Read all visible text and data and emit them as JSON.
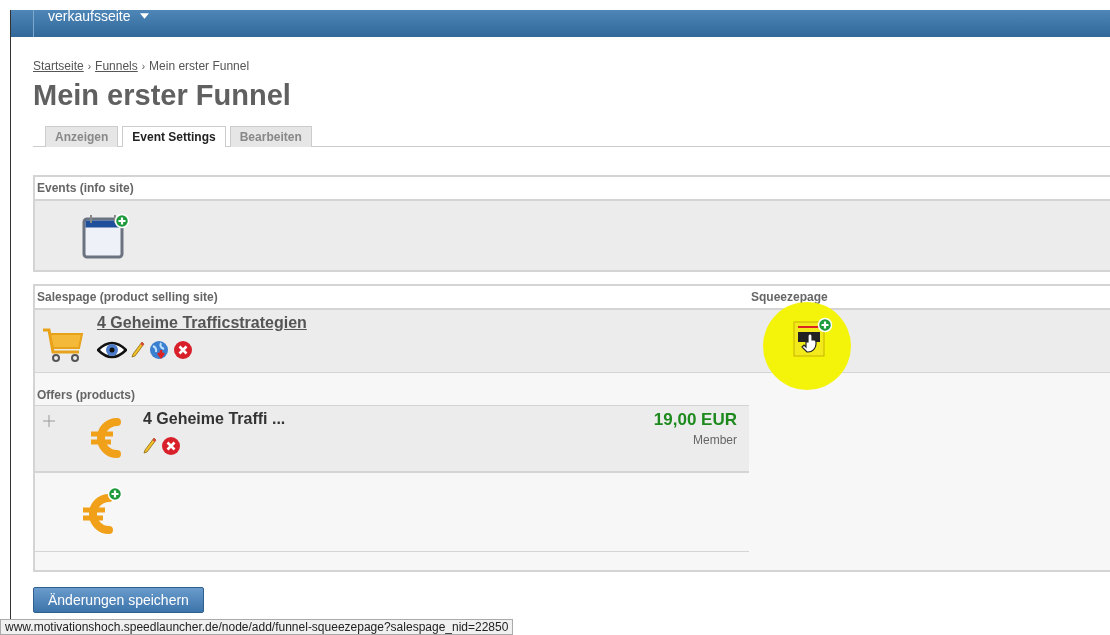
{
  "top_bar": {
    "menu_label": "verkaufsseite"
  },
  "breadcrumb": {
    "separator": "›",
    "items": [
      {
        "label": "Startseite",
        "kind": "link"
      },
      {
        "label": "Funnels",
        "kind": "link"
      },
      {
        "label": "Mein erster Funnel",
        "kind": "current"
      }
    ]
  },
  "title": "Mein erster Funnel",
  "tabs": [
    {
      "label": "Anzeigen",
      "selected": false
    },
    {
      "label": "Event Settings",
      "selected": true
    },
    {
      "label": "Bearbeiten",
      "selected": false
    }
  ],
  "events": {
    "heading": "Events (info site)"
  },
  "salespage": {
    "heading": "Salespage (product selling site)",
    "name": "4 Geheime Trafficstrategien"
  },
  "squeezepage": {
    "heading": "Squeezepage",
    "cursor_highlight": true
  },
  "offers": {
    "heading": "Offers (products)",
    "items": [
      {
        "name": "4 Geheime Traffi ...",
        "price": "19,00 EUR",
        "group": "Member"
      }
    ]
  },
  "save_button": "Änderungen speichern",
  "status_bar": "www.motivationshoch.speedlauncher.de/node/add/funnel-squeezepage?salespage_nid=22850"
}
